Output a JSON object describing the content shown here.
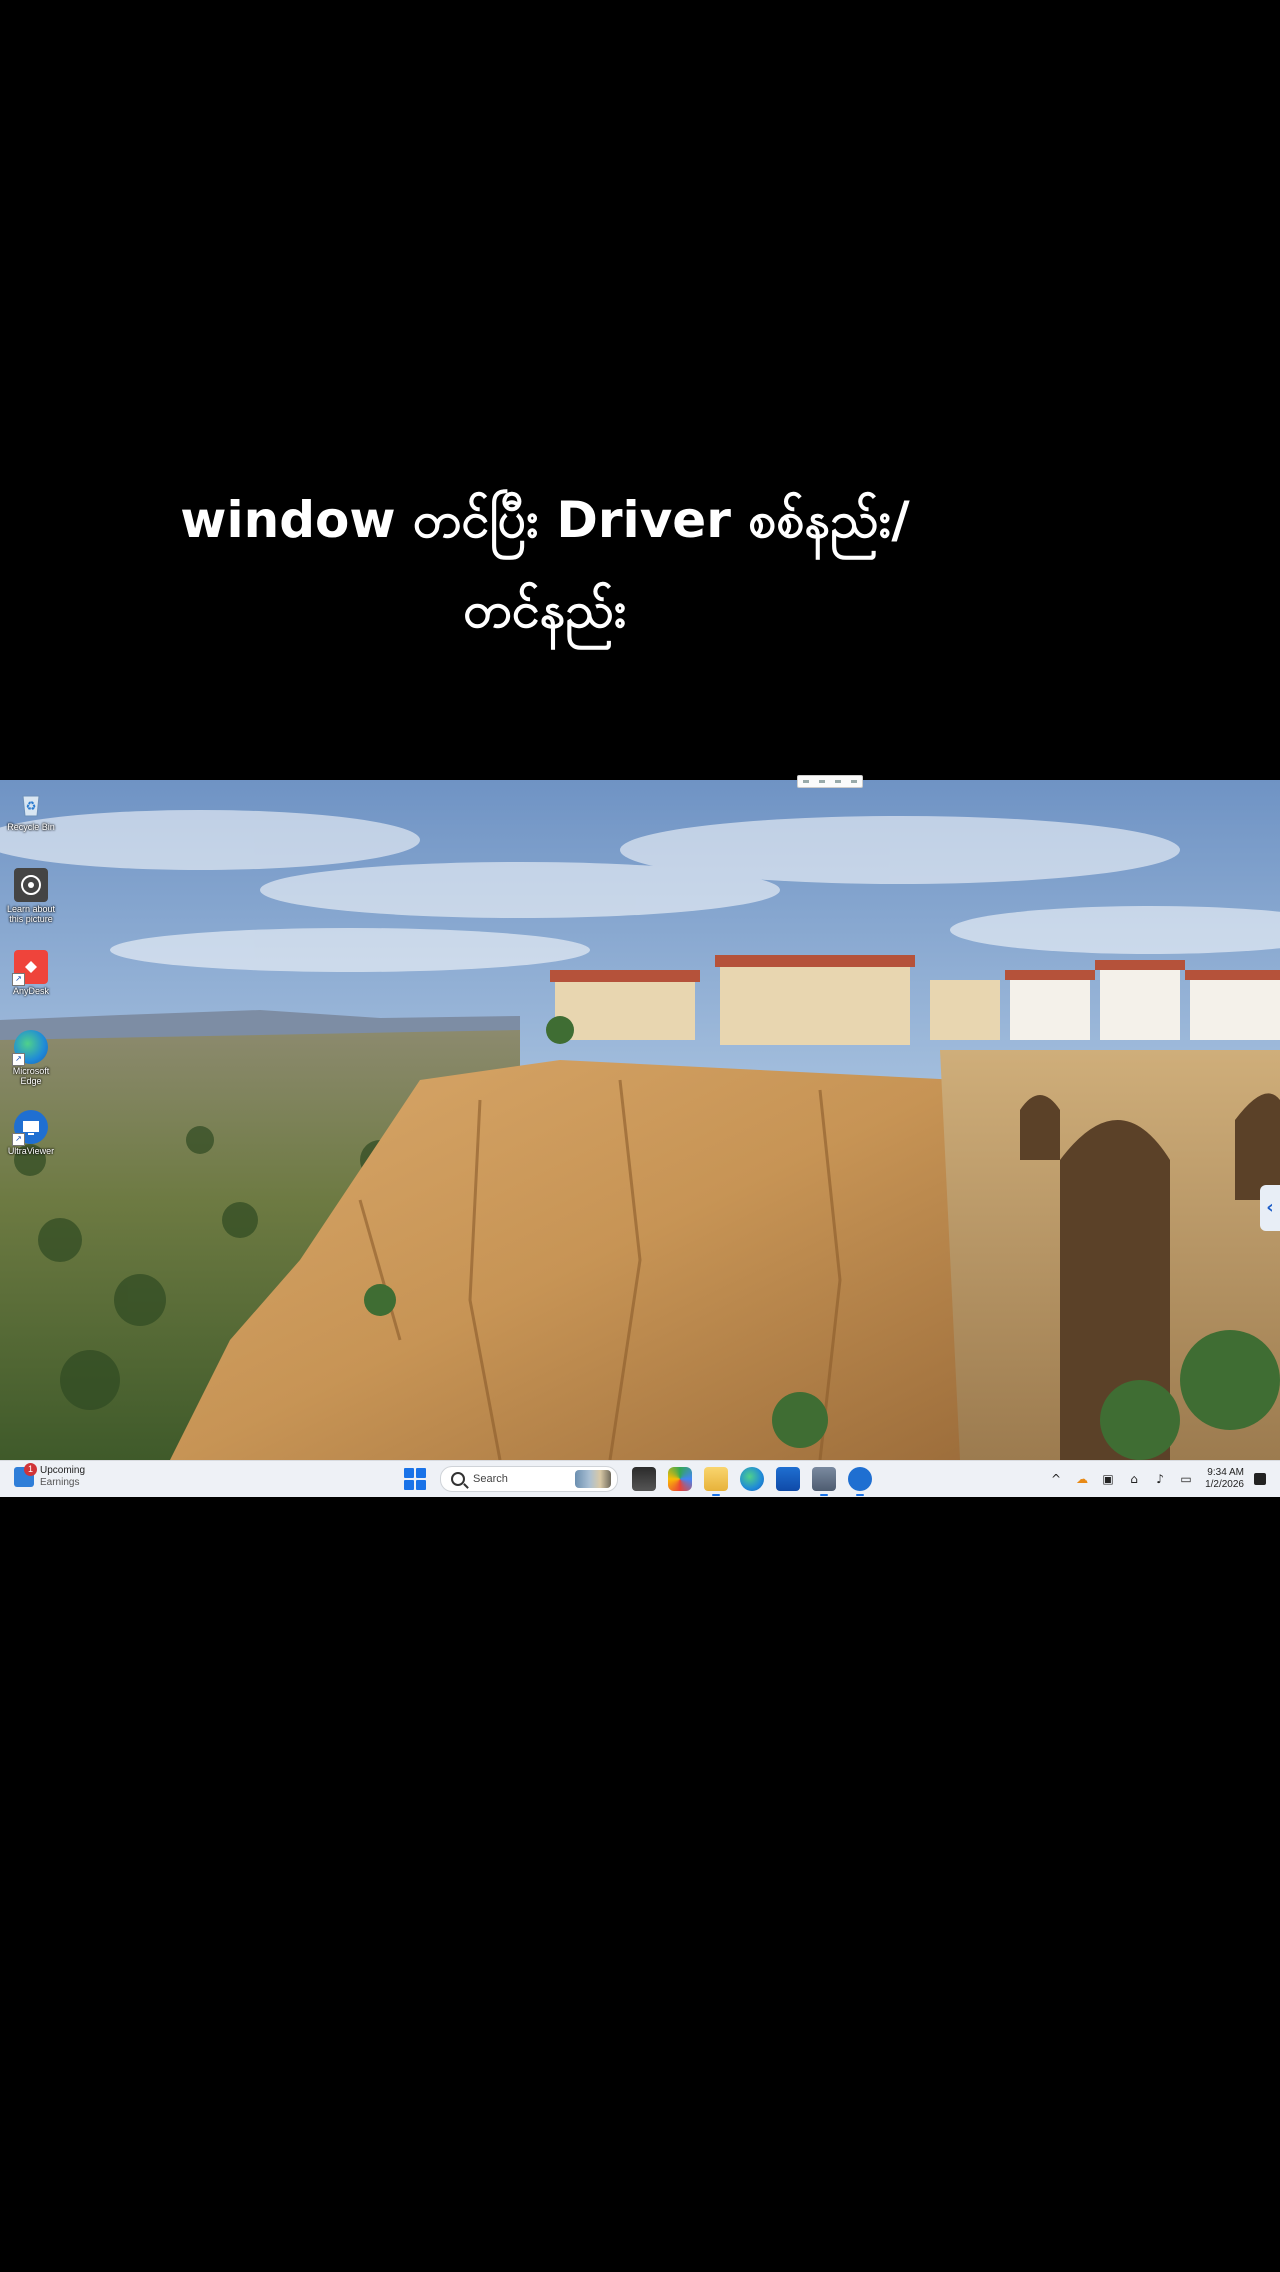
{
  "overlay": {
    "title_line1": "window တင်ပြီး Driver စစ်နည်း/",
    "title_line2": "တင်နည်း"
  },
  "desktop": {
    "icons": [
      {
        "label": "Recycle Bin",
        "icon": "recycle-bin-icon"
      },
      {
        "label": "Learn about this picture",
        "icon": "camera-icon"
      },
      {
        "label": "AnyDesk",
        "icon": "anydesk-icon"
      },
      {
        "label": "Microsoft Edge",
        "icon": "edge-icon"
      },
      {
        "label": "UltraViewer",
        "icon": "ultraviewer-icon"
      }
    ]
  },
  "taskbar": {
    "widget": {
      "badge": "1",
      "line1": "Upcoming",
      "line2": "Earnings"
    },
    "search_placeholder": "Search",
    "apps": [
      "file-explorer-icon",
      "copilot-icon",
      "folder-icon",
      "edge-icon",
      "store-icon",
      "network-icon",
      "ultraviewer-icon"
    ],
    "tray": {
      "icons": [
        "chevron-up-icon",
        "onedrive-icon",
        "display-icon",
        "network-icon",
        "volume-icon",
        "battery-icon"
      ],
      "time": "9:34 AM",
      "date": "1/2/2026"
    }
  },
  "colors": {
    "accent": "#1a73e8",
    "taskbar_bg": "#eef1f6",
    "badge": "#d13438"
  }
}
